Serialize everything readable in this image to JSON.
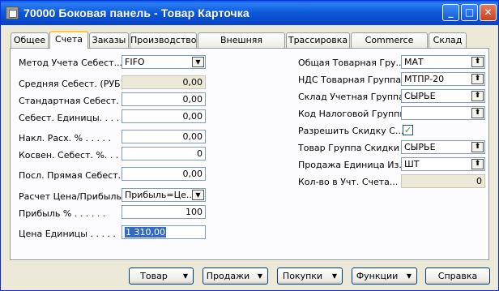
{
  "window": {
    "title": "70000 Боковая панель - Товар Карточка"
  },
  "titlebar_buttons": {
    "minimize": "_",
    "maximize": "□",
    "close": "✕"
  },
  "tabs": [
    "Общее",
    "Счета",
    "Заказы",
    "Производство",
    "Внешняя Торговля",
    "Трассировка",
    "Commerce Portal",
    "Склад"
  ],
  "active_tab": "Счета",
  "left": {
    "costing_method": {
      "label": "Метод Учета Себест...",
      "value": "FIFO"
    },
    "avg_cost": {
      "label": "Средняя Себест. (РУБ).",
      "value": "0,00"
    },
    "std_cost": {
      "label": "Стандартная Себест.  .",
      "value": "0,00"
    },
    "unit_cost": {
      "label": "Себест. Единицы. . . .",
      "value": "0,00"
    },
    "overhead_pct": {
      "label": "Накл. Расх. %  . . . . .",
      "value": "0,00"
    },
    "indirect_pct": {
      "label": "Косвен. Себест. %. . .",
      "value": "0"
    },
    "last_direct_cost": {
      "label": "Посл. Прямая Себест.  .",
      "value": "0,00"
    },
    "price_profit_calc": {
      "label": "Расчет Цена/Прибыль  .",
      "value": "Прибыль=Це..."
    },
    "profit_pct": {
      "label": "Прибыль %  . . . . . .",
      "value": "100"
    },
    "unit_price": {
      "label": "Цена Единицы . . . . .",
      "value": "1 310,00"
    }
  },
  "right": {
    "gen_prod_posting_group": {
      "label": "Общая Товарная Гру...",
      "value": "МАТ"
    },
    "vat_prod_posting_group": {
      "label": "НДС Товарная Группа .",
      "value": "МТПР-20"
    },
    "inventory_posting_group": {
      "label": "Склад Учетная Группа.",
      "value": "СЫРЬЕ"
    },
    "tax_group_code": {
      "label": "Код Налоговой Группы.",
      "value": ""
    },
    "allow_invoice_disc": {
      "label": "Разрешить Скидку С...",
      "checked": true
    },
    "item_disc_group": {
      "label": "Товар Группа Скидки  .",
      "value": "СЫРЬЕ"
    },
    "sales_unit_of_measure": {
      "label": "Продажа Единица Из...",
      "value": "ШТ"
    },
    "qty_on_ledger": {
      "label": "Кол-во в Учт. Счета...",
      "value": "0"
    }
  },
  "buttons": {
    "item": "Товар",
    "sales": "Продажи",
    "purchases": "Покупки",
    "functions": "Функции",
    "help": "Справка"
  },
  "glyphs": {
    "dropdown": "▼",
    "lookup": "⬆",
    "check": "✓",
    "menu_arrow": "▼"
  }
}
